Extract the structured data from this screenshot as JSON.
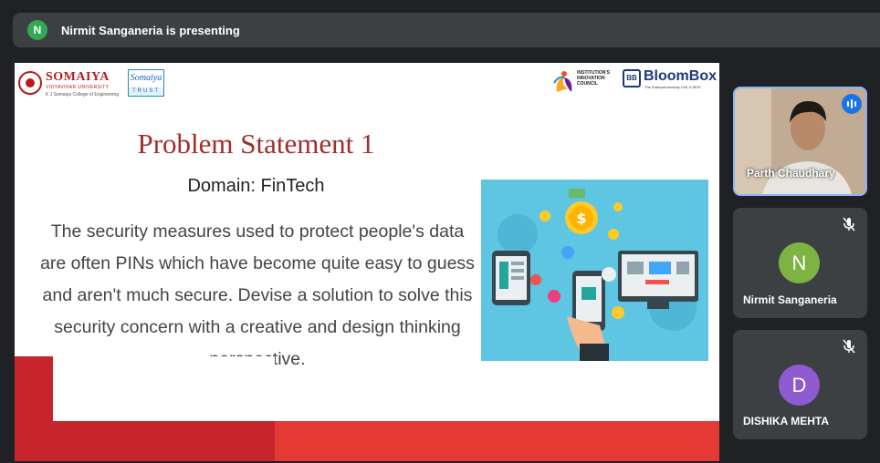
{
  "presenting_bar": {
    "avatar_initial": "N",
    "text": "Nirmit Sanganeria is presenting"
  },
  "slide": {
    "logos": {
      "somaiya_name": "SOMAIYA",
      "somaiya_sub": "VIDYAVIHAR UNIVERSITY",
      "somaiya_college": "K J Somaiya College of Engineering",
      "trust_script": "Somaiya",
      "trust_band": "TRUST",
      "iic_text": "INSTITUTION'S INNOVATION COUNCIL",
      "bloombox_mark": "BB",
      "bloombox_name": "BloomBox",
      "bloombox_tag": "The Entrepreneurship Cell, KJSCE"
    },
    "title": "Problem Statement 1",
    "domain": "Domain: FinTech",
    "body": "The security measures used to protect people's data are often PINs which have become quite easy to guess and aren't much secure. Devise a solution to solve this security concern with a creative and design thinking perspective."
  },
  "participants": [
    {
      "name": "Parth Chaudhary",
      "initial": "",
      "speaking": true,
      "muted": false
    },
    {
      "name": "Nirmit Sanganeria",
      "initial": "N",
      "avatar_color": "#7cb342",
      "muted": true
    },
    {
      "name": "DISHIKA MEHTA",
      "initial": "D",
      "avatar_color": "#8e5bd0",
      "muted": true
    }
  ],
  "icons": [
    "speaking-icon",
    "mic-off-icon"
  ]
}
